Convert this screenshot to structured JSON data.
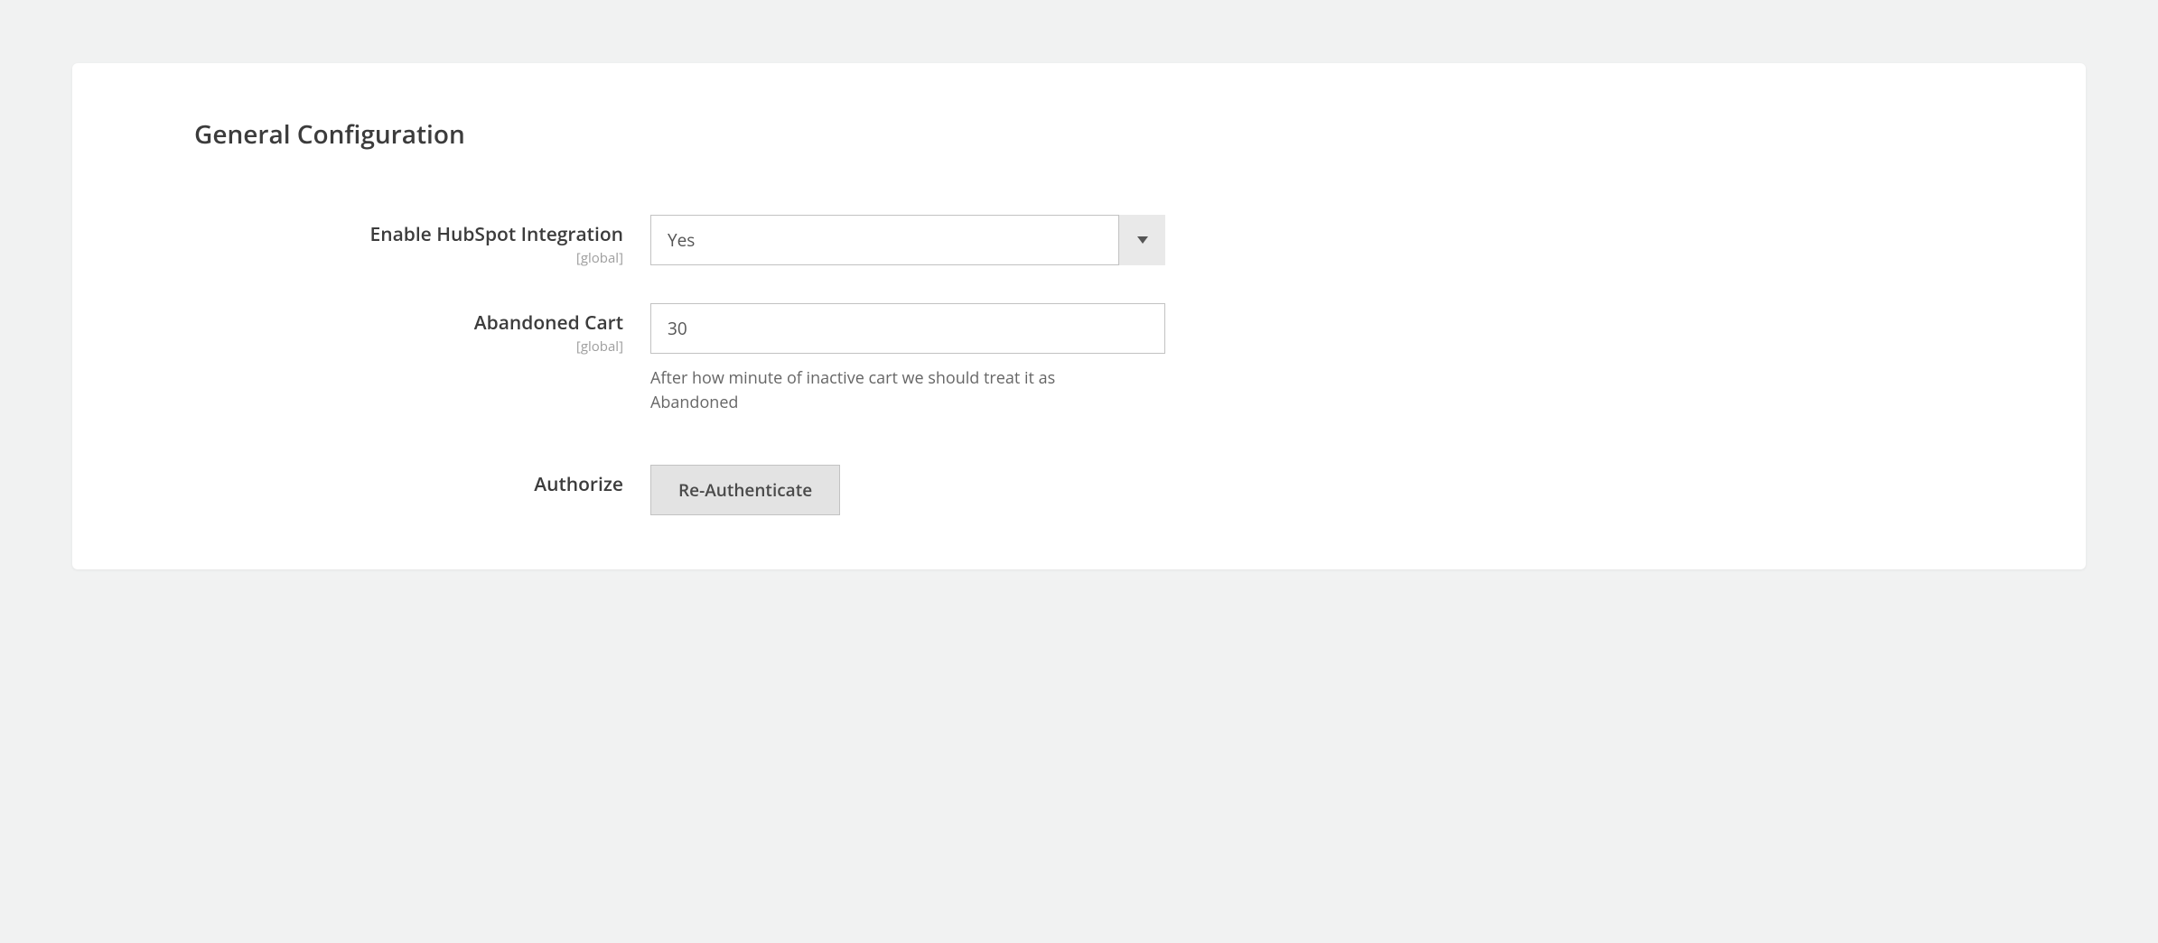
{
  "section": {
    "title": "General Configuration"
  },
  "fields": {
    "enable": {
      "label": "Enable HubSpot Integration",
      "scope": "[global]",
      "value": "Yes"
    },
    "abandoned": {
      "label": "Abandoned Cart",
      "scope": "[global]",
      "value": "30",
      "help": "After how minute of inactive cart we should treat it as Abandoned"
    },
    "authorize": {
      "label": "Authorize",
      "button": "Re-Authenticate"
    }
  }
}
